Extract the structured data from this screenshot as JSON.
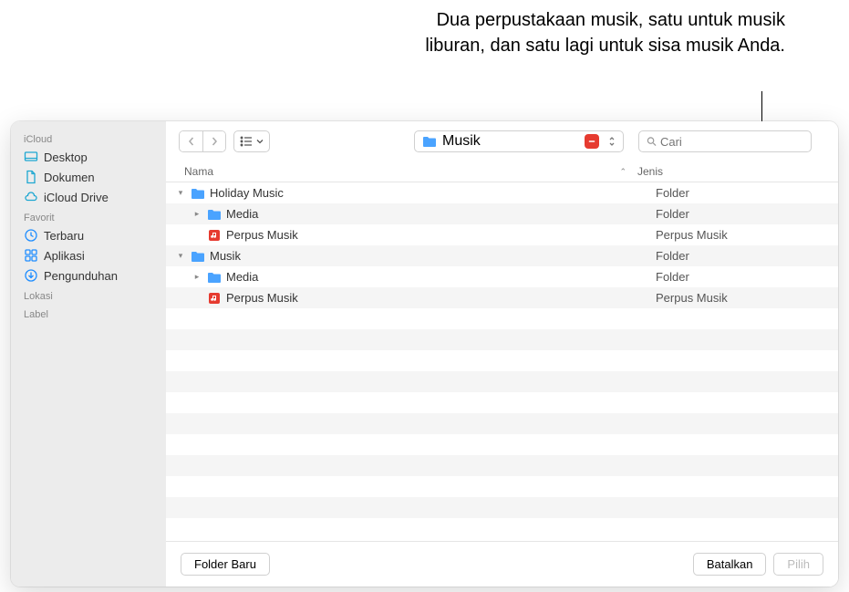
{
  "annotation": "Dua perpustakaan musik, satu untuk musik liburan, dan satu lagi untuk sisa musik Anda.",
  "sidebar": {
    "sections": [
      {
        "title": "iCloud",
        "items": [
          {
            "icon": "desktop",
            "label": "Desktop"
          },
          {
            "icon": "document",
            "label": "Dokumen"
          },
          {
            "icon": "cloud",
            "label": "iCloud Drive"
          }
        ]
      },
      {
        "title": "Favorit",
        "items": [
          {
            "icon": "clock",
            "label": "Terbaru"
          },
          {
            "icon": "appgrid",
            "label": "Aplikasi"
          },
          {
            "icon": "download",
            "label": "Pengunduhan"
          }
        ]
      },
      {
        "title": "Lokasi",
        "items": []
      },
      {
        "title": "Label",
        "items": []
      }
    ]
  },
  "toolbar": {
    "location": "Musik",
    "search_placeholder": "Cari"
  },
  "columns": {
    "name": "Nama",
    "kind": "Jenis"
  },
  "rows": [
    {
      "indent": 0,
      "disclosure": "down",
      "icon": "folder",
      "name": "Holiday Music",
      "kind": "Folder"
    },
    {
      "indent": 1,
      "disclosure": "right",
      "icon": "folder",
      "name": "Media",
      "kind": "Folder"
    },
    {
      "indent": 1,
      "disclosure": "none",
      "icon": "musiclib",
      "name": "Perpus Musik",
      "kind": "Perpus Musik"
    },
    {
      "indent": 0,
      "disclosure": "down",
      "icon": "folder",
      "name": "Musik",
      "kind": "Folder"
    },
    {
      "indent": 1,
      "disclosure": "right",
      "icon": "folder",
      "name": "Media",
      "kind": "Folder"
    },
    {
      "indent": 1,
      "disclosure": "none",
      "icon": "musiclib",
      "name": "Perpus Musik",
      "kind": "Perpus Musik"
    }
  ],
  "footer": {
    "new_folder": "Folder Baru",
    "cancel": "Batalkan",
    "choose": "Pilih"
  }
}
